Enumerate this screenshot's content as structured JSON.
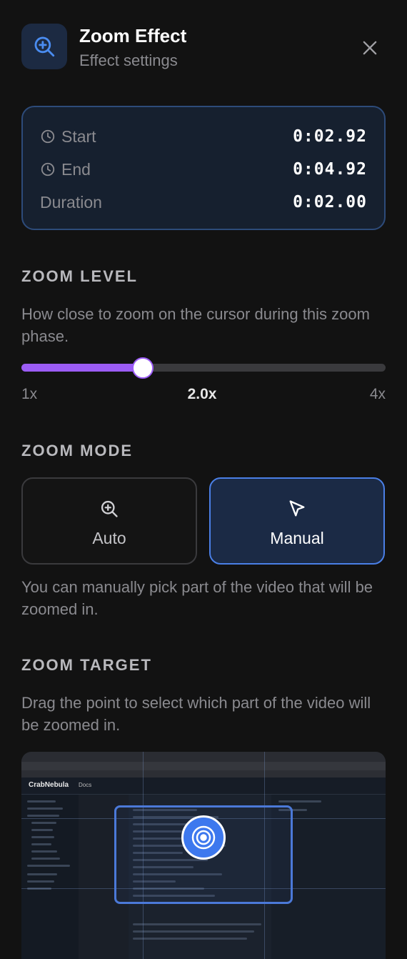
{
  "header": {
    "title": "Zoom Effect",
    "subtitle": "Effect settings",
    "icon": "zoom-in-icon"
  },
  "timing": {
    "start": {
      "label": "Start",
      "value": "0:02.92"
    },
    "end": {
      "label": "End",
      "value": "0:04.92"
    },
    "duration": {
      "label": "Duration",
      "value": "0:02.00"
    }
  },
  "zoom_level": {
    "heading": "ZOOM LEVEL",
    "description": "How close to zoom on the cursor during this zoom phase.",
    "min_label": "1x",
    "current_label": "2.0x",
    "max_label": "4x",
    "min": 1,
    "max": 4,
    "value": 2.0
  },
  "zoom_mode": {
    "heading": "ZOOM MODE",
    "options": [
      {
        "label": "Auto",
        "icon": "zoom-in-icon",
        "selected": false
      },
      {
        "label": "Manual",
        "icon": "cursor-arrow-icon",
        "selected": true
      }
    ],
    "description": "You can manually pick part of the video that will be zoomed in."
  },
  "zoom_target": {
    "heading": "ZOOM TARGET",
    "description": "Drag the point to select which part of the video will be zoomed in.",
    "preview": {
      "logo": "CrabNebula",
      "section": "Docs"
    }
  },
  "colors": {
    "accent_purple": "#9b5cf5",
    "accent_blue": "#4a7fe6",
    "background": "#121212"
  }
}
